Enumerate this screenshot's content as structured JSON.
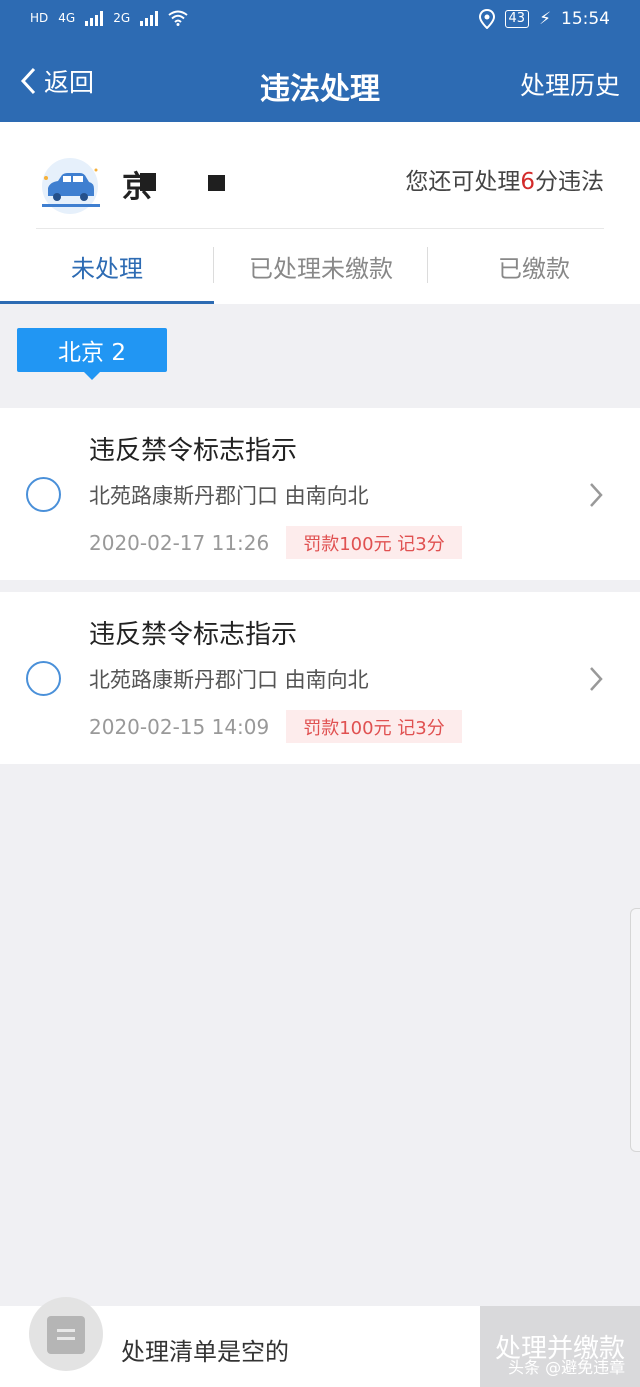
{
  "status_bar": {
    "network_left": "HD",
    "sim1": "4G",
    "sim2": "2G",
    "battery": "43",
    "time": "15:54"
  },
  "nav": {
    "back_label": "返回",
    "title": "违法处理",
    "history_label": "处理历史"
  },
  "account": {
    "plate_prefix": "京",
    "points_prefix": "您还可处理",
    "points_value": "6",
    "points_suffix": "分违法"
  },
  "tabs": [
    {
      "label": "未处理",
      "active": true
    },
    {
      "label": "已处理未缴款",
      "active": false
    },
    {
      "label": "已缴款",
      "active": false
    }
  ],
  "region_chip": "北京 2",
  "violations": [
    {
      "title": "违反禁令标志指示",
      "location": "北苑路康斯丹郡门口 由南向北",
      "time": "2020-02-17 11:26",
      "fine": "罚款100元 记3分"
    },
    {
      "title": "违反禁令标志指示",
      "location": "北苑路康斯丹郡门口 由南向北",
      "time": "2020-02-15 14:09",
      "fine": "罚款100元 记3分"
    }
  ],
  "bottom": {
    "empty_text": "处理清单是空的",
    "pay_button": "处理并缴款",
    "watermark": "头条 @避免违章"
  },
  "colors": {
    "header": "#2d6bb3",
    "accent": "#2196f3",
    "points_red": "#d32a2a",
    "fine_text": "#e05151"
  }
}
